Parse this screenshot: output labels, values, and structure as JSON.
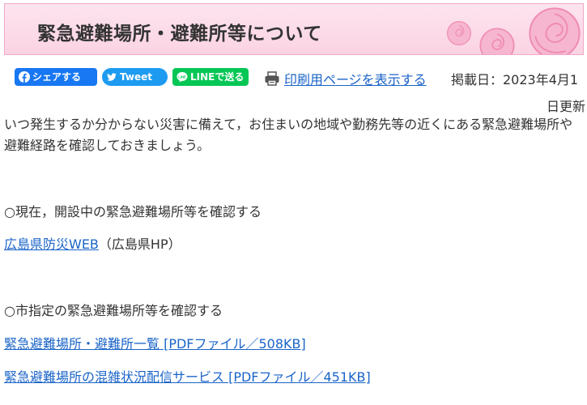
{
  "page": {
    "title": "緊急避難場所・避難所等について"
  },
  "share": {
    "facebook_label": "シェアする",
    "twitter_label": "Tweet",
    "line_label": "LINEで送る"
  },
  "print": {
    "label": "印刷用ページを表示する"
  },
  "published": {
    "line1": "掲載日：2023年4月1",
    "line2": "日更新"
  },
  "content": {
    "intro": "いつ発生するか分からない災害に備えて，お住まいの地域や勤務先等の近くにある緊急避難場所や避難経路を確認しておきましょう。",
    "section1_heading": "○現在，開設中の緊急避難場所等を確認する",
    "link1_text": "広島県防災WEB",
    "link1_suffix": "（広島県HP）",
    "section2_heading": "○市指定の緊急避難場所等を確認する",
    "link2_text": "緊急避難場所・避難所一覧 [PDFファイル／508KB]",
    "link3_text": "緊急避難場所の混雑状況配信サービス [PDFファイル／451KB]"
  },
  "colors": {
    "banner_bg": "#fbd3e3",
    "link": "#1a64c8",
    "facebook": "#1877f2",
    "twitter": "#1d9bf0",
    "line": "#06c755"
  },
  "icons": {
    "banner_decoration": "rose-icon",
    "print": "printer-icon",
    "facebook": "facebook-icon",
    "twitter": "twitter-bird-icon",
    "line": "line-chat-icon"
  }
}
